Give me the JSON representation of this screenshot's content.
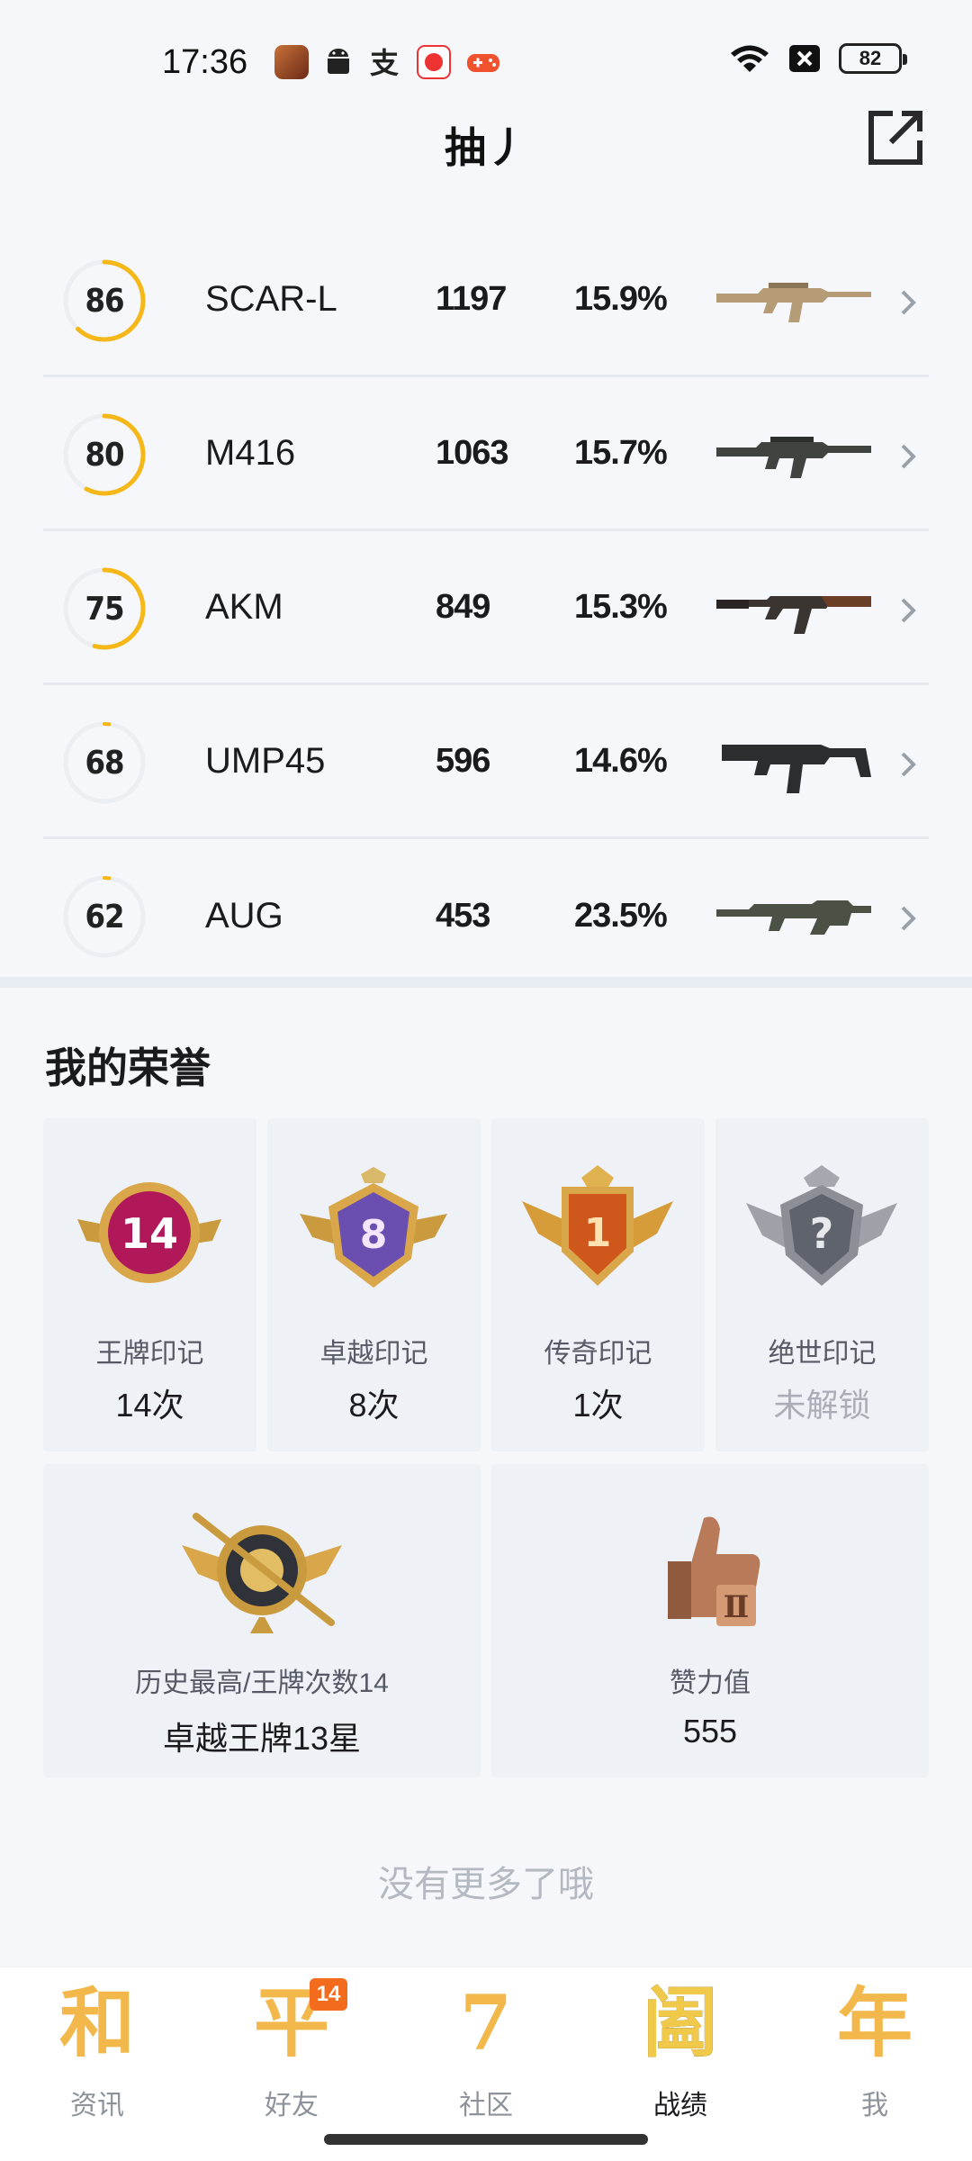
{
  "status_bar": {
    "time": "17:36",
    "battery": "82",
    "app_icons": [
      "game-avatar-icon",
      "android-icon",
      "alipay-icon",
      "news-app-icon",
      "gamepad-icon"
    ],
    "right_icons": [
      "wifi-icon",
      "signal-off-icon",
      "battery-icon"
    ]
  },
  "header": {
    "title": "抽丿",
    "share_icon": "share-external-icon"
  },
  "weapons": [
    {
      "score": "86",
      "score_value": 0.86,
      "name": "SCAR-L",
      "count": "1197",
      "rate": "15.9%",
      "highlight": true,
      "gun_color": "#b69c76"
    },
    {
      "score": "80",
      "score_value": 0.8,
      "name": "M416",
      "count": "1063",
      "rate": "15.7%",
      "highlight": true,
      "gun_color": "#3f4440"
    },
    {
      "score": "75",
      "score_value": 0.75,
      "name": "AKM",
      "count": "849",
      "rate": "15.3%",
      "highlight": true,
      "gun_color": "#5b3b2a"
    },
    {
      "score": "68",
      "score_value": 0.68,
      "name": "UMP45",
      "count": "596",
      "rate": "14.6%",
      "highlight": false,
      "gun_color": "#2b2d2e"
    },
    {
      "score": "62",
      "score_value": 0.62,
      "name": "AUG",
      "count": "453",
      "rate": "23.5%",
      "highlight": false,
      "gun_color": "#4c5145"
    }
  ],
  "honors": {
    "title": "我的荣誉",
    "badges": [
      {
        "icon": "ace-mark-badge-icon",
        "number": "14",
        "label": "王牌印记",
        "value": "14次",
        "locked": false,
        "color": "#b0185a"
      },
      {
        "icon": "elite-mark-badge-icon",
        "number": "8",
        "label": "卓越印记",
        "value": "8次",
        "locked": false,
        "color": "#6b4fb0"
      },
      {
        "icon": "legend-mark-badge-icon",
        "number": "1",
        "label": "传奇印记",
        "value": "1次",
        "locked": false,
        "color": "#d0571b"
      },
      {
        "icon": "peerless-mark-badge-icon",
        "number": "?",
        "label": "绝世印记",
        "value": "未解锁",
        "locked": true,
        "color": "#7b7e86"
      }
    ],
    "big_cards": [
      {
        "icon": "highest-rank-emblem-icon",
        "label": "历史最高/王牌次数14",
        "value": "卓越王牌13星"
      },
      {
        "icon": "thumbs-up-trophy-icon",
        "label": "赞力值",
        "value": "555"
      }
    ]
  },
  "no_more": "没有更多了哦",
  "nav": {
    "items": [
      {
        "glyph": "和",
        "label": "资讯",
        "icon": "news-tab-icon",
        "active": false
      },
      {
        "glyph": "平",
        "label": "好友",
        "icon": "friends-tab-icon",
        "active": false,
        "badge": "14"
      },
      {
        "glyph": "7",
        "label": "社区",
        "icon": "community-tab-icon",
        "active": false
      },
      {
        "glyph": "阖",
        "label": "战绩",
        "icon": "stats-tab-icon",
        "active": true
      },
      {
        "glyph": "年",
        "label": "我",
        "icon": "me-tab-icon",
        "active": false
      }
    ]
  },
  "colors": {
    "ring_active": "#f5b818",
    "ring_track": "#ebeef3",
    "accent_orange": "#f36b1c"
  }
}
